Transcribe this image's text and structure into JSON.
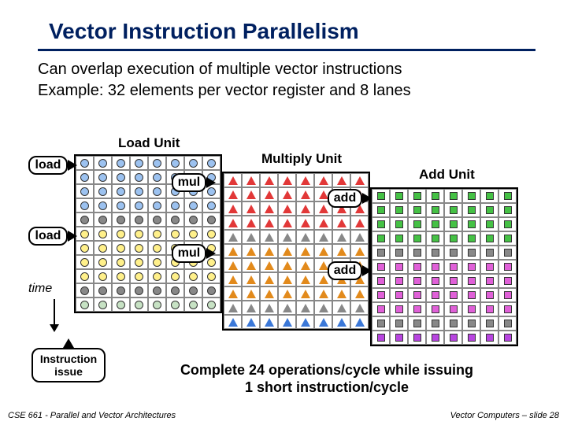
{
  "title": "Vector Instruction Parallelism",
  "intro_line1": "Can overlap execution of multiple vector instructions",
  "intro_line2": "Example: 32 elements per vector register and 8 lanes",
  "labels": {
    "load_unit": "Load Unit",
    "multiply_unit": "Multiply Unit",
    "add_unit": "Add Unit",
    "load": "load",
    "mul": "mul",
    "add": "add",
    "time": "time",
    "instruction_issue": "Instruction issue"
  },
  "conclusion_line1": "Complete 24 operations/cycle while issuing",
  "conclusion_line2": "1 short instruction/cycle",
  "footer_left": "CSE 661 - Parallel and Vector Architectures",
  "footer_right": "Vector Computers – slide 28",
  "chart_data": {
    "type": "diagram",
    "lanes": 8,
    "rows_per_unit": 11,
    "units": [
      {
        "name": "Load Unit",
        "shape": "circle",
        "issue_cycles": [
          1,
          6
        ],
        "colors_by_row": [
          "#9cc2f0",
          "#9cc2f0",
          "#9cc2f0",
          "#9cc2f0",
          "#888",
          "#fff08a",
          "#fff08a",
          "#fff08a",
          "#fff08a",
          "#888",
          "#c7e2c4"
        ]
      },
      {
        "name": "Multiply Unit",
        "shape": "triangle",
        "issue_cycles": [
          2,
          7
        ],
        "colors_by_row": [
          "#e23838",
          "#e23838",
          "#e23838",
          "#e23838",
          "#888",
          "#e28a1c",
          "#e28a1c",
          "#e28a1c",
          "#e28a1c",
          "#888",
          "#3b78d8"
        ]
      },
      {
        "name": "Add Unit",
        "shape": "square",
        "issue_cycles": [
          3,
          8
        ],
        "colors_by_row": [
          "#45c145",
          "#45c145",
          "#45c145",
          "#45c145",
          "#888",
          "#e060d8",
          "#e060d8",
          "#e060d8",
          "#e060d8",
          "#888",
          "#b845e0"
        ]
      }
    ]
  }
}
